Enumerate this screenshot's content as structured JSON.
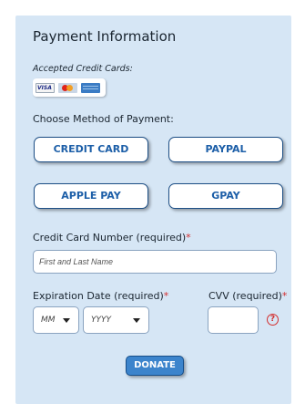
{
  "form": {
    "title": "Payment Information",
    "accepted_label": "Accepted Credit Cards:",
    "accepted_cards": [
      "visa-icon",
      "mastercard-icon",
      "amex-icon"
    ],
    "visa_text": "VISA",
    "method_label": "Choose Method of Payment:",
    "methods": [
      {
        "label": "CREDIT CARD"
      },
      {
        "label": "PAYPAL"
      },
      {
        "label": "APPLE PAY"
      },
      {
        "label": "GPAY"
      }
    ],
    "card_number": {
      "label": "Credit Card Number (required)",
      "required_mark": "*",
      "placeholder": "First and Last Name",
      "value": ""
    },
    "expiration": {
      "label": "Expiration Date (required)",
      "required_mark": "*",
      "month": "MM",
      "year": "YYYY"
    },
    "cvv": {
      "label": "CVV (required)",
      "required_mark": "*",
      "value": "",
      "help_glyph": "?"
    },
    "donate_label": "DONATE"
  },
  "colors": {
    "panel_bg": "#d6e6f5",
    "button_text": "#1d5fa8",
    "button_border": "#1d4f86",
    "donate_bg": "#3c84cc",
    "required": "#d32f2f"
  }
}
